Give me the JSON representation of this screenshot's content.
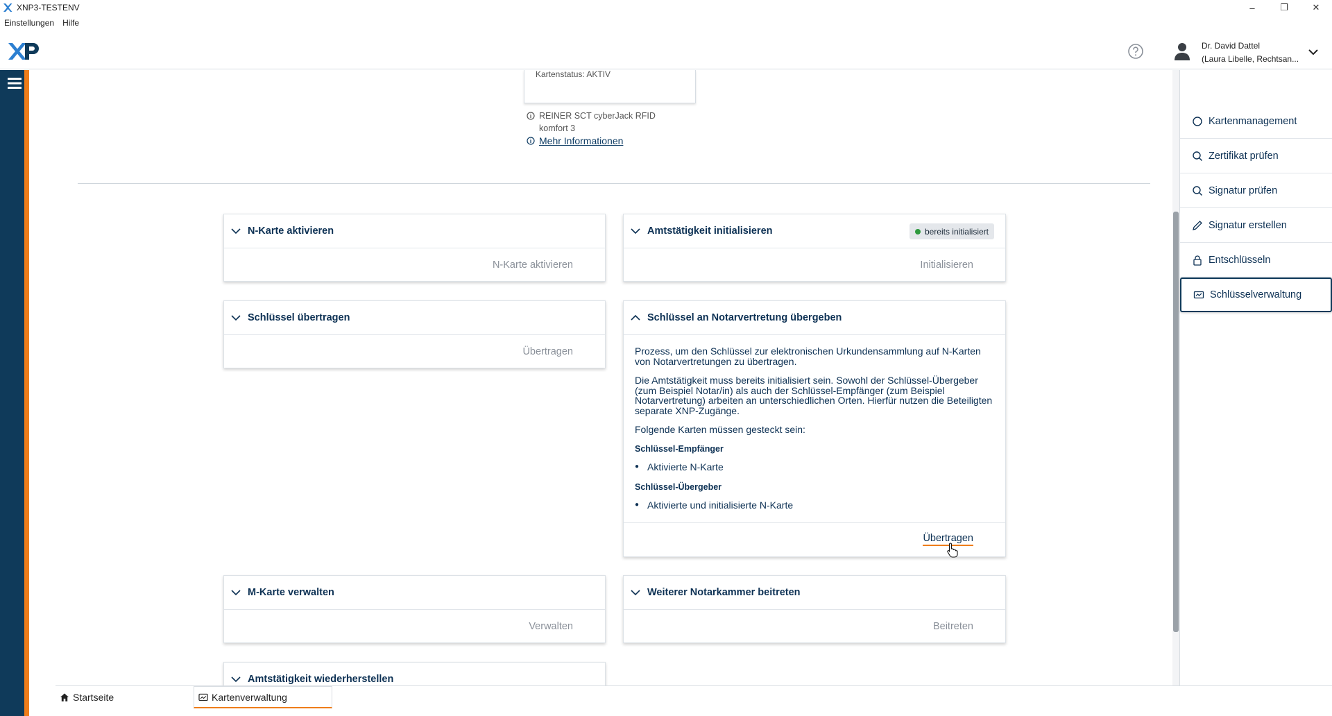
{
  "window": {
    "title": "XNP3-TESTENV",
    "minimize": "–",
    "maximize": "❐",
    "close": "✕"
  },
  "menu": {
    "items": [
      "Einstellungen",
      "Hilfe"
    ]
  },
  "header": {
    "user_line1": "Dr. David Dattel",
    "user_line2": "(Laura Libelle, Rechtsan..."
  },
  "card": {
    "status": "Kartenstatus: AKTIV",
    "reader_line1": "REINER SCT cyberJack RFID",
    "reader_line2": "komfort 3",
    "more_info": "Mehr Informationen"
  },
  "panels": {
    "n_karte": {
      "title": "N-Karte aktivieren",
      "action": "N-Karte aktivieren"
    },
    "amt_init": {
      "title": "Amtstätigkeit initialisieren",
      "badge": "bereits initialisiert",
      "action": "Initialisieren"
    },
    "schluessel": {
      "title": "Schlüssel übertragen",
      "action": "Übertragen"
    },
    "notarvertretung": {
      "title": "Schlüssel an Notarvertretung übergeben",
      "para1": "Prozess, um den Schlüssel zur elektronischen Urkundensammlung auf N-Karten von Notarvertretungen zu übertragen.",
      "para2": "Die Amtstätigkeit muss bereits initialisiert sein. Sowohl der Schlüssel-Übergeber (zum Beispiel Notar/in) als auch der Schlüssel-Empfänger (zum Beispiel Notarvertretung) arbeiten an unterschiedlichen Orten. Hierfür nutzen die Beteiligten separate XNP-Zugänge.",
      "para3": "Folgende Karten müssen gesteckt sein:",
      "sub1": "Schlüssel-Empfänger",
      "bullet1": "Aktivierte N-Karte",
      "sub2": "Schlüssel-Übergeber",
      "bullet2": "Aktivierte und initialisierte N-Karte",
      "action": "Übertragen"
    },
    "m_karte": {
      "title": "M-Karte verwalten",
      "action": "Verwalten"
    },
    "notarkammer": {
      "title": "Weiterer Notarkammer beitreten",
      "action": "Beitreten"
    },
    "wiederherstellen": {
      "title": "Amtstätigkeit wiederherstellen"
    }
  },
  "sidebar": {
    "items": [
      {
        "label": "Kartenmanagement",
        "icon": "circle-icon"
      },
      {
        "label": "Zertifikat prüfen",
        "icon": "search-icon"
      },
      {
        "label": "Signatur prüfen",
        "icon": "search-icon"
      },
      {
        "label": "Signatur erstellen",
        "icon": "pen-icon"
      },
      {
        "label": "Entschlüsseln",
        "icon": "lock-icon"
      },
      {
        "label": "Schlüsselverwaltung",
        "icon": "card-icon"
      }
    ]
  },
  "tabs": {
    "home": "Startseite",
    "cards": "Kartenverwaltung"
  },
  "colors": {
    "navy": "#0f3a5a",
    "orange": "#ef7d1a",
    "text": "#0d3154",
    "success": "#2e9a3e"
  }
}
